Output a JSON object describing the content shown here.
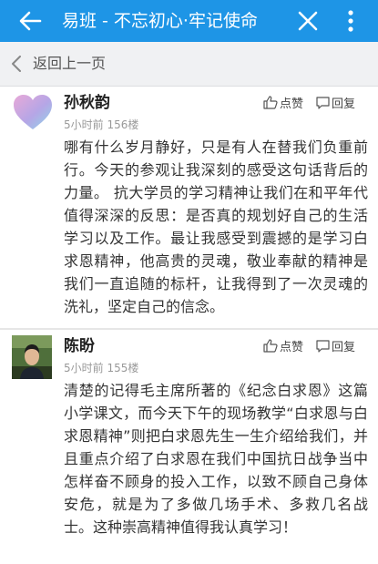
{
  "header": {
    "title": "易班 - 不忘初心·牢记使命",
    "back_icon": "arrow-left-icon",
    "close_icon": "close-icon",
    "more_icon": "more-vertical-icon",
    "bg_color": "#1e95e6"
  },
  "backbar": {
    "label": "返回上一页",
    "icon": "chevron-left-icon"
  },
  "posts": [
    {
      "username": "孙秋韵",
      "meta": "5小时前 156楼",
      "like_label": "点赞",
      "reply_label": "回复",
      "avatar": "heart-avatar",
      "body": "哪有什么岁月静好，只是有人在替我们负重前行。今天的参观让我深刻的感受这句话背后的力量。 抗大学员的学习精神让我们在和平年代值得深深的反思：是否真的规划好自己的生活学习以及工作。最让我感受到震撼的是学习白求恩精神，他高贵的灵魂，敬业奉献的精神是我们一直追随的标杆，让我得到了一次灵魂的洗礼，坚定自己的信念。"
    },
    {
      "username": "陈盼",
      "meta": "5小时前 155楼",
      "like_label": "点赞",
      "reply_label": "回复",
      "avatar": "photo-avatar",
      "body": "清楚的记得毛主席所著的《纪念白求恩》这篇小学课文，而今天下午的现场教学“白求恩与白求恩精神”则把白求恩先生一生介绍给我们，并且重点介绍了白求恩在我们中国抗日战争当中怎样奋不顾身的投入工作，以致不顾自己身体安危，就是为了多做几场手术、多救几名战士。这种崇高精神值得我认真学习！"
    }
  ]
}
